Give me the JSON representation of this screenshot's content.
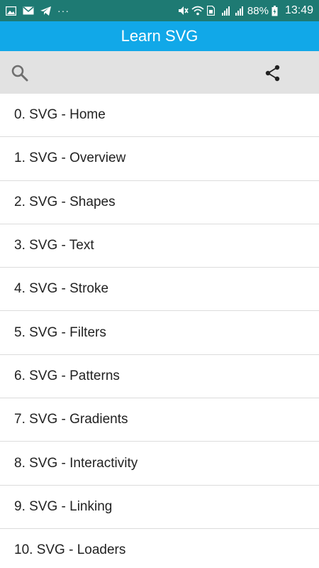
{
  "status_bar": {
    "battery_pct": "88%",
    "clock": "13:49"
  },
  "app_bar": {
    "title": "Learn SVG"
  },
  "toolbar": {
    "search_icon": "search-icon",
    "share_icon": "share-icon"
  },
  "list": {
    "items": [
      {
        "label": "0. SVG - Home"
      },
      {
        "label": "1. SVG - Overview"
      },
      {
        "label": "2. SVG - Shapes"
      },
      {
        "label": "3. SVG - Text"
      },
      {
        "label": "4. SVG - Stroke"
      },
      {
        "label": "5. SVG - Filters"
      },
      {
        "label": "6. SVG - Patterns"
      },
      {
        "label": "7. SVG - Gradients"
      },
      {
        "label": "8. SVG - Interactivity"
      },
      {
        "label": "9. SVG - Linking"
      },
      {
        "label": "10. SVG - Loaders"
      }
    ]
  },
  "colors": {
    "status_bar": "#1e7a73",
    "app_bar": "#11a8e8",
    "toolbar": "#e2e2e2"
  }
}
